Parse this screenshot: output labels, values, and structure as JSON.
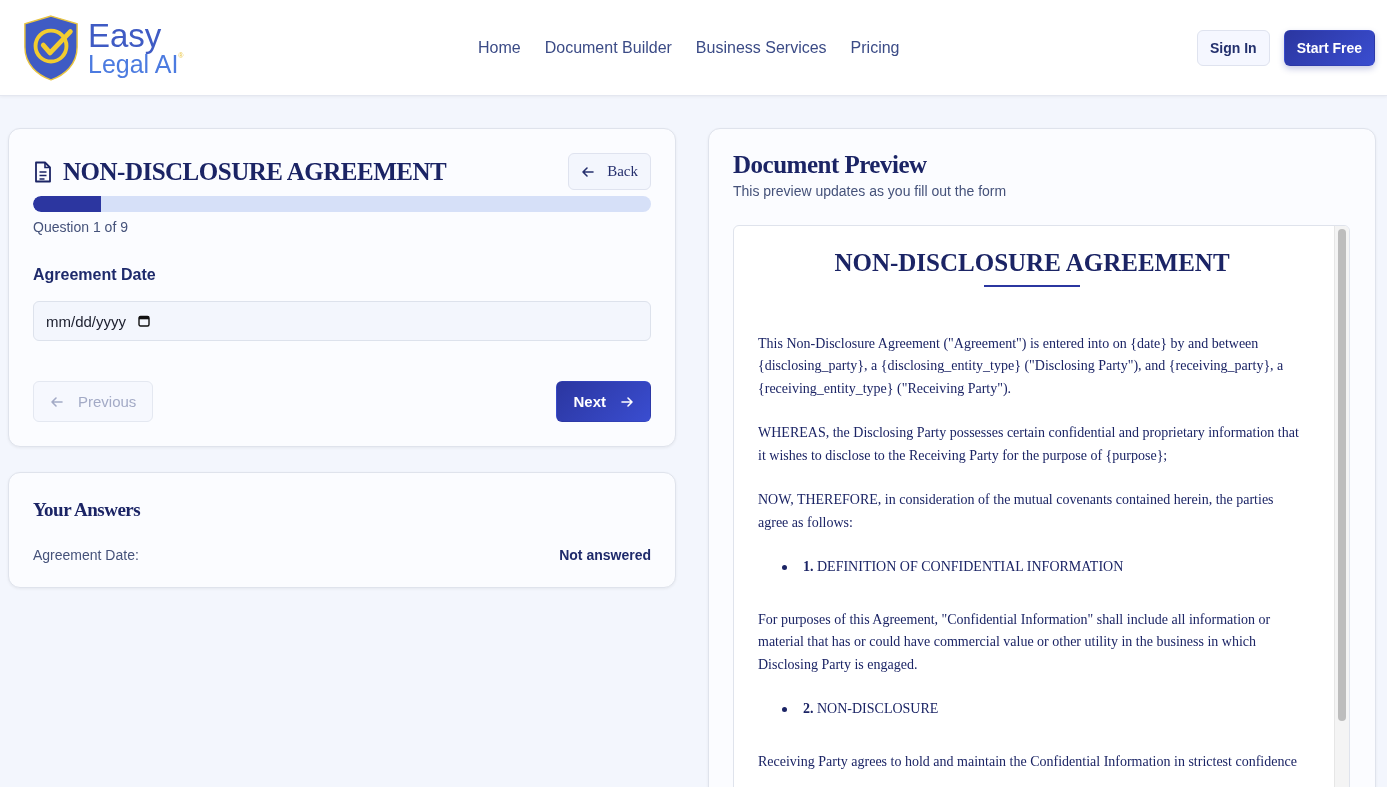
{
  "header": {
    "logo": {
      "line1": "Easy",
      "line2": "Legal AI",
      "mark": "®"
    },
    "nav": [
      {
        "label": "Home"
      },
      {
        "label": "Document Builder"
      },
      {
        "label": "Business Services"
      },
      {
        "label": "Pricing"
      }
    ],
    "buttons": [
      {
        "label": "Sign In",
        "kind": "secondary"
      },
      {
        "label": "Start Free",
        "kind": "primary"
      }
    ]
  },
  "form_card": {
    "title": "NON-DISCLOSURE AGREEMENT",
    "back": "Back",
    "progress": {
      "level": 0.11
    },
    "progress_text": "Question 1 of 9",
    "question": "Agreement Date",
    "field": {
      "placeholder": "mm/dd/yyyy"
    },
    "previous": {
      "label": "Previous",
      "disabled": true
    },
    "next": {
      "label": "Next",
      "disabled": false
    }
  },
  "answers_card": {
    "title": "Your Answers",
    "rows": [
      {
        "label": "Agreement Date:",
        "value": "Not answered"
      }
    ]
  },
  "preview": {
    "title": "Document Preview",
    "subtitle": "This preview updates as you fill out the form",
    "doc_title": "NON-DISCLOSURE AGREEMENT",
    "blocks": [
      {
        "kind": "paragraph",
        "text": "This Non-Disclosure Agreement (\"Agreement\") is entered into on {date} by and between {disclosing_party}, a {disclosing_entity_type} (\"Disclosing Party\"), and {receiving_party}, a {receiving_entity_type} (\"Receiving Party\")."
      },
      {
        "kind": "paragraph",
        "text": "WHEREAS, the Disclosing Party possesses certain confidential and proprietary information that it wishes to disclose to the Receiving Party for the purpose of {purpose};"
      },
      {
        "kind": "paragraph",
        "text": "NOW, THEREFORE, in consideration of the mutual covenants contained herein, the parties agree as follows:"
      },
      {
        "kind": "section",
        "text": "**1.** DEFINITION OF CONFIDENTIAL INFORMATION"
      },
      {
        "kind": "paragraph",
        "text": "For purposes of this Agreement, \"Confidential Information\" shall include all information or material that has or could have commercial value or other utility in the business in which Disclosing Party is engaged."
      },
      {
        "kind": "section",
        "text": "**2.** NON-DISCLOSURE"
      },
      {
        "kind": "paragraph",
        "text": "Receiving Party agrees to hold and maintain the Confidential Information in strictest confidence"
      }
    ]
  }
}
